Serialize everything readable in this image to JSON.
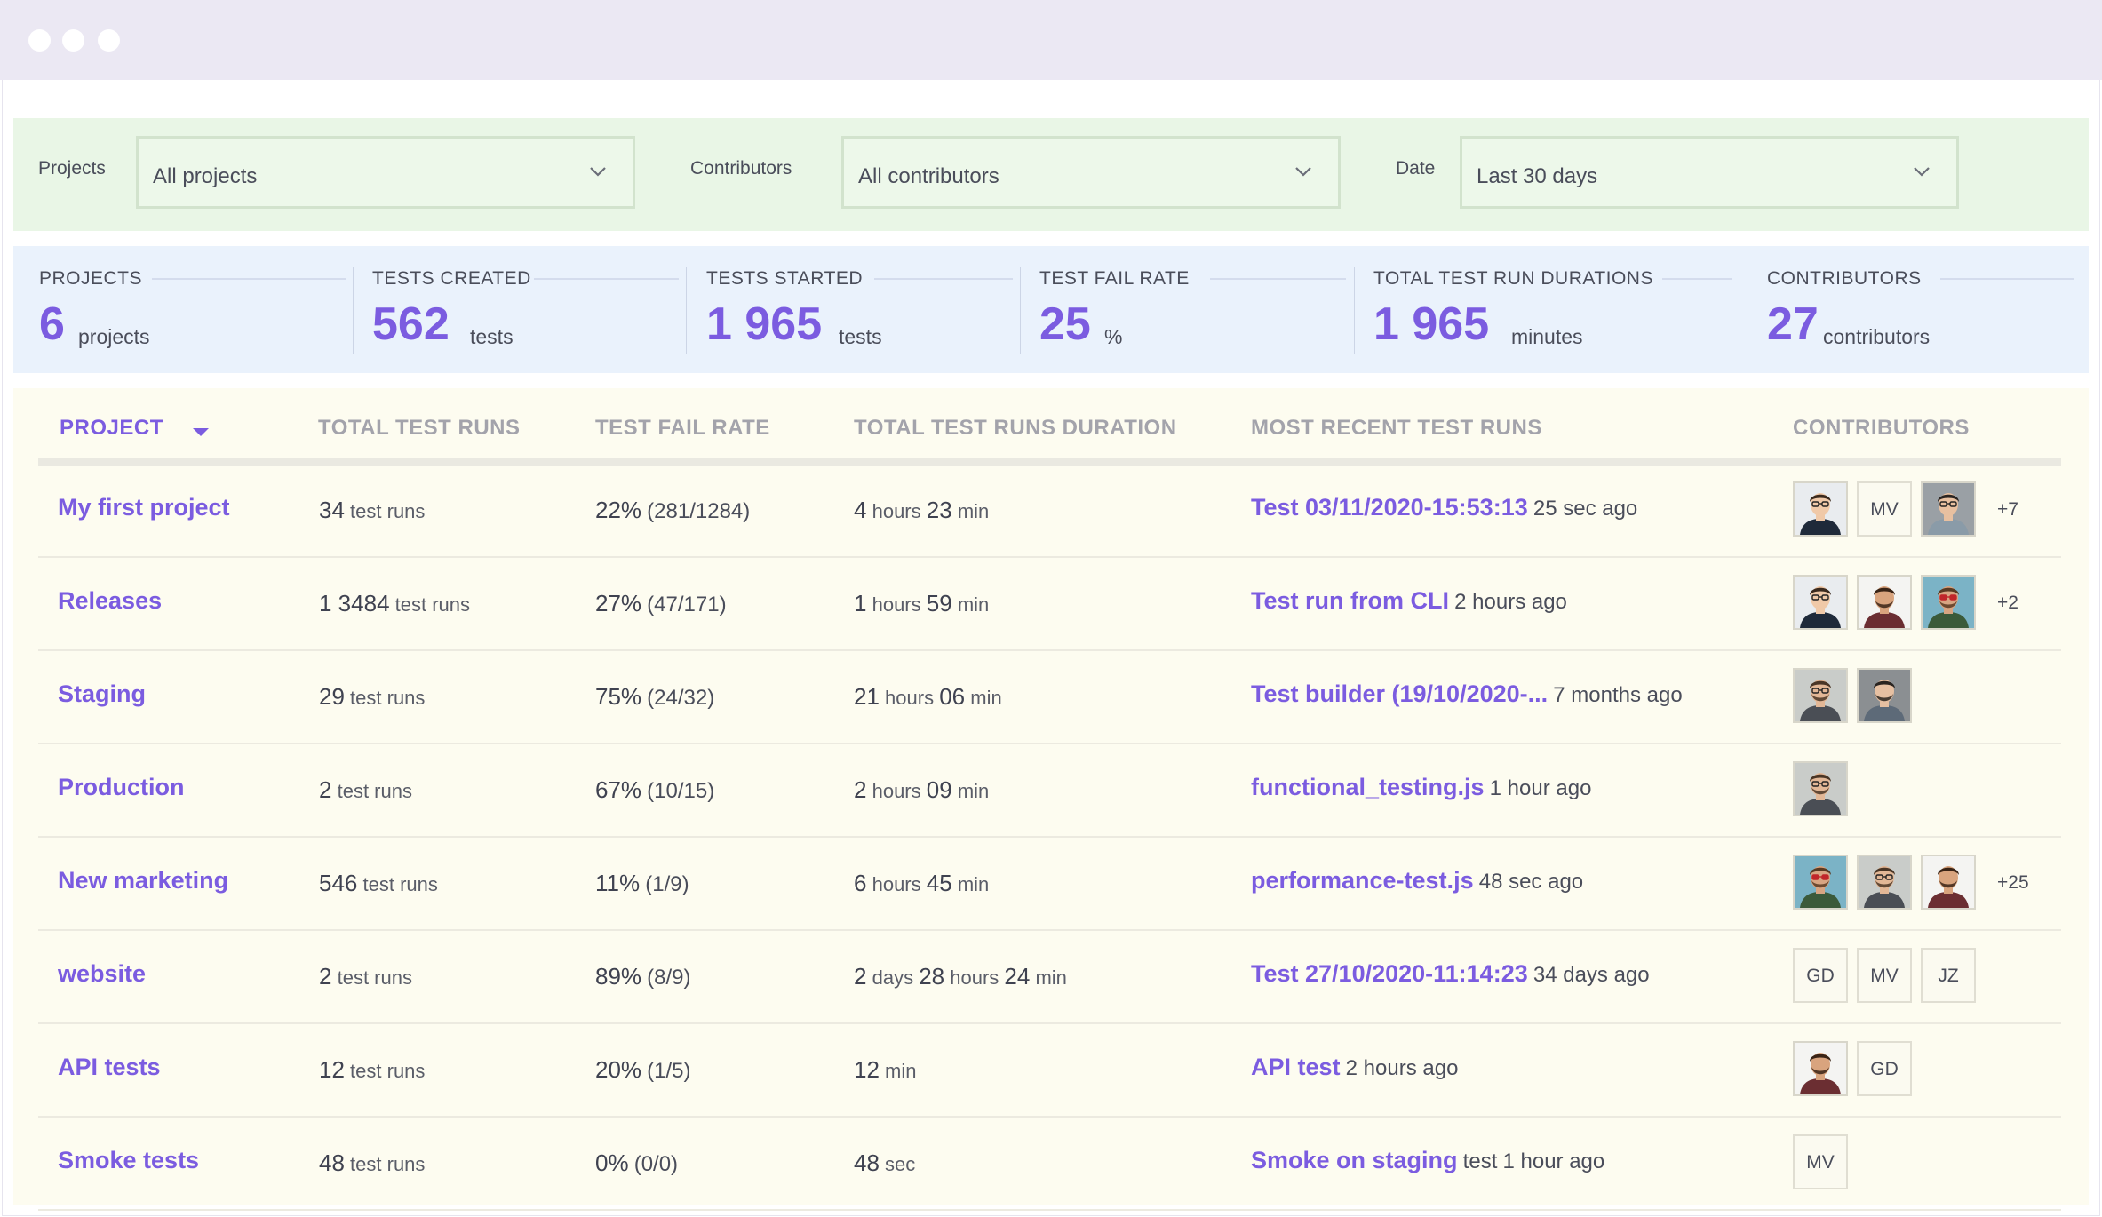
{
  "filters": {
    "projects_label": "Projects",
    "projects_value": "All projects",
    "contributors_label": "Contributors",
    "contributors_value": "All contributors",
    "date_label": "Date",
    "date_value": "Last 30 days"
  },
  "stats": [
    {
      "label": "PROJECTS",
      "value": "6",
      "unit": "projects"
    },
    {
      "label": "TESTS CREATED",
      "value": "562",
      "unit": "tests"
    },
    {
      "label": "TESTS STARTED",
      "value": "1 965",
      "unit": "tests"
    },
    {
      "label": "TEST FAIL RATE",
      "value": "25",
      "unit": "%"
    },
    {
      "label": "TOTAL TEST RUN DURATIONS",
      "value": "1 965",
      "unit": "minutes"
    },
    {
      "label": "CONTRIBUTORS",
      "value": "27",
      "unit": "contributors"
    }
  ],
  "table": {
    "headers": [
      "PROJECT",
      "TOTAL TEST RUNS",
      "TEST FAIL RATE",
      "TOTAL TEST RUNS DURATION",
      "MOST RECENT TEST RUNS",
      "CONTRIBUTORS"
    ],
    "rows": [
      {
        "project": "My first project",
        "runs": "34",
        "runs_unit": "test runs",
        "fail": "22%",
        "fail_detail": "(281/1284)",
        "dur": [
          [
            "4",
            "hours"
          ],
          [
            "23",
            "min"
          ]
        ],
        "recent": "Test 03/11/2020-15:53:13",
        "recent_extra": "",
        "ago": "25 sec ago",
        "contributors": [
          "photo:a",
          "init:MV",
          "photo:b"
        ],
        "more": "+7"
      },
      {
        "project": "Releases",
        "runs": "1 3484",
        "runs_unit": "test runs",
        "fail": "27%",
        "fail_detail": "(47/171)",
        "dur": [
          [
            "1",
            "hours"
          ],
          [
            "59",
            "min"
          ]
        ],
        "recent": "Test run from CLI",
        "recent_extra": "",
        "ago": "2 hours ago",
        "contributors": [
          "photo:a",
          "photo:c",
          "photo:d"
        ],
        "more": "+2"
      },
      {
        "project": "Staging",
        "runs": "29",
        "runs_unit": "test runs",
        "fail": "75%",
        "fail_detail": "(24/32)",
        "dur": [
          [
            "21",
            "hours"
          ],
          [
            "06",
            "min"
          ]
        ],
        "recent": "Test builder (19/10/2020-...",
        "recent_extra": "",
        "ago": "7 months ago",
        "contributors": [
          "photo:e",
          "photo:f"
        ],
        "more": ""
      },
      {
        "project": "Production",
        "runs": "2",
        "runs_unit": "test runs",
        "fail": "67%",
        "fail_detail": "(10/15)",
        "dur": [
          [
            "2",
            "hours"
          ],
          [
            "09",
            "min"
          ]
        ],
        "recent": "functional_testing.js",
        "recent_extra": "",
        "ago": "1 hour ago",
        "contributors": [
          "photo:e"
        ],
        "more": ""
      },
      {
        "project": "New marketing",
        "runs": "546",
        "runs_unit": "test runs",
        "fail": "11%",
        "fail_detail": "(1/9)",
        "dur": [
          [
            "6",
            "hours"
          ],
          [
            "45",
            "min"
          ]
        ],
        "recent": "performance-test.js",
        "recent_extra": "",
        "ago": "48 sec ago",
        "contributors": [
          "photo:d",
          "photo:e",
          "photo:c"
        ],
        "more": "+25"
      },
      {
        "project": "website",
        "runs": "2",
        "runs_unit": "test runs",
        "fail": "89%",
        "fail_detail": "(8/9)",
        "dur": [
          [
            "2",
            "days"
          ],
          [
            "28",
            "hours"
          ],
          [
            "24",
            "min"
          ]
        ],
        "recent": "Test 27/10/2020-11:14:23",
        "recent_extra": "",
        "ago": "34 days ago",
        "contributors": [
          "init:GD",
          "init:MV",
          "init:JZ"
        ],
        "more": ""
      },
      {
        "project": "API tests",
        "runs": "12",
        "runs_unit": "test runs",
        "fail": "20%",
        "fail_detail": "(1/5)",
        "dur": [
          [
            "12",
            "min"
          ]
        ],
        "recent": "API test",
        "recent_extra": "",
        "ago": "2 hours ago",
        "contributors": [
          "photo:c",
          "init:GD"
        ],
        "more": ""
      },
      {
        "project": "Smoke tests",
        "runs": "48",
        "runs_unit": "test runs",
        "fail": "0%",
        "fail_detail": "(0/0)",
        "dur": [
          [
            "48",
            "sec"
          ]
        ],
        "recent": "Smoke on staging",
        "recent_extra": "test",
        "ago": "1 hour ago",
        "contributors": [
          "init:MV"
        ],
        "more": ""
      }
    ]
  },
  "colors": {
    "accent": "#7b5ce0",
    "filter_bg": "#e9f6e6",
    "stats_bg": "#eaf2fc",
    "table_bg": "#fdfcf0"
  },
  "icons": {
    "dropdown": "chevron-down-icon",
    "sort": "sort-desc-icon",
    "avatar": "person-photo-icon"
  }
}
